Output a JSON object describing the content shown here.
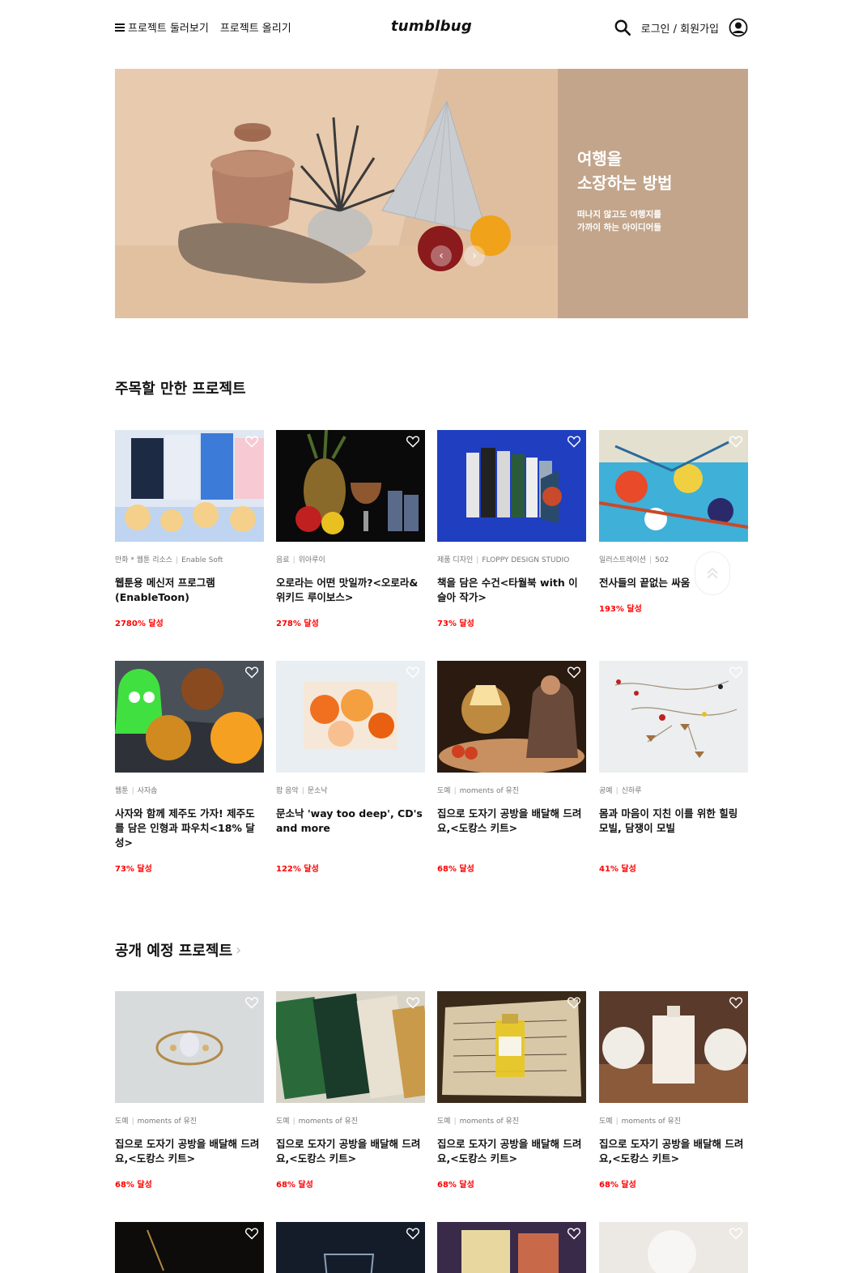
{
  "header": {
    "menu_label": "프로젝트 둘러보기",
    "upload_label": "프로젝트 올리기",
    "logo": "tumblbug",
    "login_label": "로그인 / 회원가입"
  },
  "banner": {
    "title": "여행을\n소장하는 방법",
    "subtitle": "떠나지 않고도 여행지를\n가까이 하는 아이디어들",
    "background_color": "#e7c9ac",
    "panel_color": "#c2a58b"
  },
  "featured": {
    "title": "주목할 만한 프로젝트",
    "projects": [
      {
        "category": "만화 * 웹툰 리소스",
        "creator": "Enable Soft",
        "title": "웹툰용 메신저 프로그램 (EnableToon)",
        "percent": "2780% 달성"
      },
      {
        "category": "음료",
        "creator": "위아루이",
        "title": "오로라는 어떤 맛일까?<오로라&위키드 루이보스>",
        "percent": "278% 달성"
      },
      {
        "category": "제품 디자인",
        "creator": "FLOPPY DESIGN STUDIO",
        "title": "책을 담은 수건<타월북 with 이슬아 작가>",
        "percent": "73% 달성"
      },
      {
        "category": "일러스트레이션",
        "creator": "502",
        "title": "전사들의 끝없는 싸움",
        "percent": "193% 달성"
      },
      {
        "category": "웹툰",
        "creator": "사자솜",
        "title": "사자와 함께 제주도 가자! 제주도를 담은 인형과 파우치<18% 달성>",
        "percent": "73% 달성"
      },
      {
        "category": "팝 음악",
        "creator": "문소낙",
        "title": "문소낙 'way too deep', CD's and more",
        "percent": "122% 달성"
      },
      {
        "category": "도예",
        "creator": "moments of 유진",
        "title": "집으로 도자기 공방을 배달해 드려요,<도캉스 키트>",
        "percent": "68% 달성"
      },
      {
        "category": "공예",
        "creator": "신하루",
        "title": "몸과 마음이 지친 이를 위한 힐링 모빌, 담쟁이 모빌",
        "percent": "41% 달성"
      }
    ]
  },
  "upcoming": {
    "title": "공개 예정 프로젝트",
    "projects": [
      {
        "category": "도예",
        "creator": "moments of 유진",
        "title": "집으로 도자기 공방을 배달해 드려요,<도캉스 키트>",
        "percent": "68% 달성"
      },
      {
        "category": "도예",
        "creator": "moments of 유진",
        "title": "집으로 도자기 공방을 배달해 드려요,<도캉스 키트>",
        "percent": "68% 달성"
      },
      {
        "category": "도예",
        "creator": "moments of 유진",
        "title": "집으로 도자기 공방을 배달해 드려요,<도캉스 키트>",
        "percent": "68% 달성"
      },
      {
        "category": "도예",
        "creator": "moments of 유진",
        "title": "집으로 도자기 공방을 배달해 드려요,<도캉스 키트>",
        "percent": "68% 달성"
      }
    ]
  },
  "colors": {
    "accent": "#ff0000",
    "text": "#111111",
    "meta": "#777777"
  },
  "icons": [
    "menu-icon",
    "search-icon",
    "user-icon",
    "heart-icon",
    "chevron-up-icon",
    "chevron-left-icon",
    "chevron-right-icon"
  ]
}
